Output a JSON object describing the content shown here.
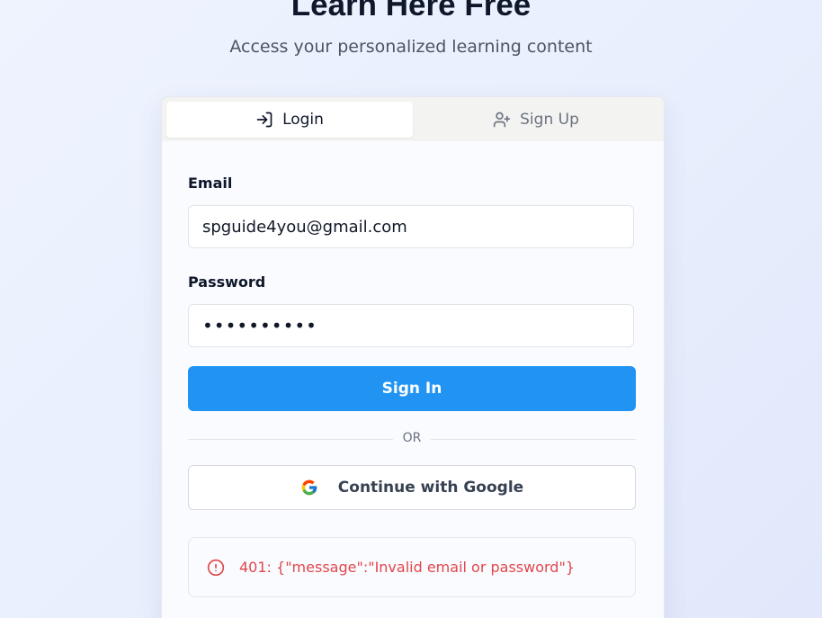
{
  "hero": {
    "title": "Learn Here Free",
    "subtitle": "Access your personalized learning content"
  },
  "tabs": [
    {
      "label": "Login",
      "icon": "login-icon",
      "active": true
    },
    {
      "label": "Sign Up",
      "icon": "user-plus-icon",
      "active": false
    }
  ],
  "form": {
    "email_label": "Email",
    "email_value": "spguide4you@gmail.com",
    "password_label": "Password",
    "password_value": "••••••••••",
    "submit_label": "Sign In",
    "divider_text": "OR",
    "google_label": "Continue with Google"
  },
  "error": {
    "icon": "alert-circle-icon",
    "message": "401: {\"message\":\"Invalid email or password\"}"
  },
  "colors": {
    "primary": "#2194f3",
    "error": "#e0474c",
    "background": "#eef3fe"
  }
}
